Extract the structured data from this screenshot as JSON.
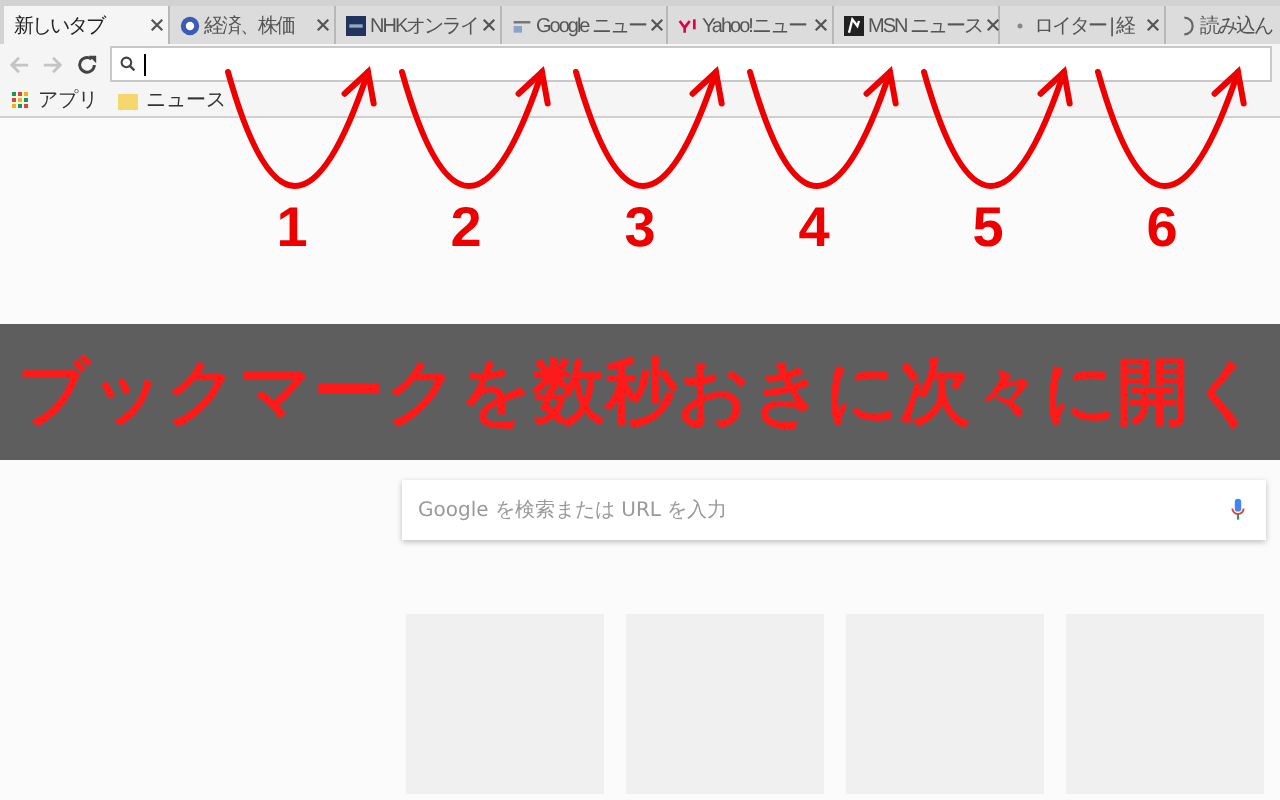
{
  "tabs": [
    {
      "title": "新しいタブ",
      "selected": true
    },
    {
      "title": "経済、株価",
      "selected": false
    },
    {
      "title": "NHKオンライ",
      "selected": false
    },
    {
      "title": "Google ニュー",
      "selected": false
    },
    {
      "title": "Yahoo!ニュー",
      "selected": false
    },
    {
      "title": "MSN ニュース",
      "selected": false
    },
    {
      "title": "ロイター | 経",
      "selected": false
    },
    {
      "title": "読み込ん",
      "selected": false
    }
  ],
  "bookmarks": [
    {
      "label": "アプリ",
      "kind": "apps"
    },
    {
      "label": "ニュース",
      "kind": "folder"
    }
  ],
  "annotations": [
    {
      "label": "1"
    },
    {
      "label": "2"
    },
    {
      "label": "3"
    },
    {
      "label": "4"
    },
    {
      "label": "5"
    },
    {
      "label": "6"
    }
  ],
  "banner": "ブックマークを数秒おきに次々に開く",
  "search": {
    "placeholder": "Google を検索または URL を入力"
  }
}
